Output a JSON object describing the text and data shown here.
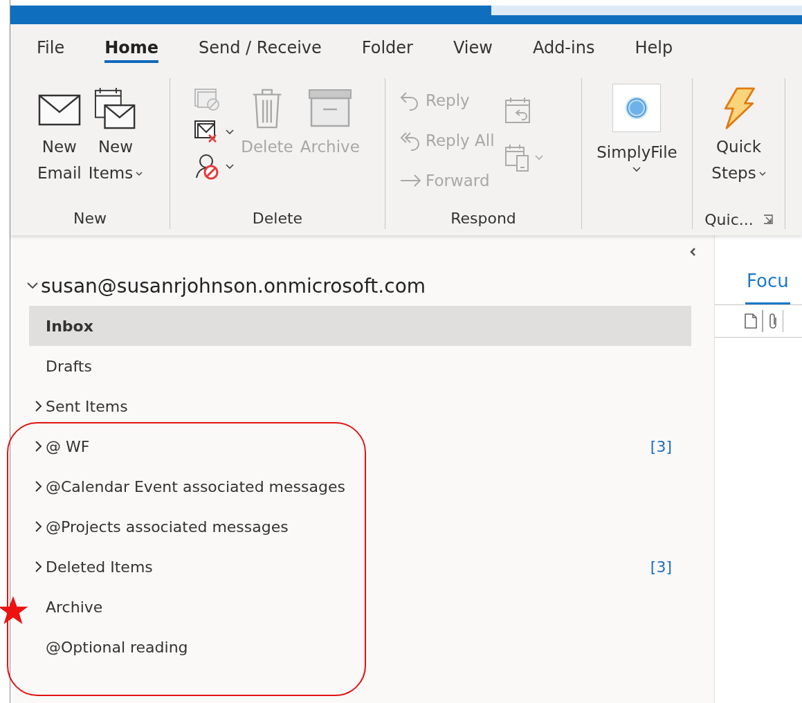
{
  "tabs": [
    {
      "label": "File",
      "selected": false
    },
    {
      "label": "Home",
      "selected": true
    },
    {
      "label": "Send / Receive",
      "selected": false
    },
    {
      "label": "Folder",
      "selected": false
    },
    {
      "label": "View",
      "selected": false
    },
    {
      "label": "Add-ins",
      "selected": false
    },
    {
      "label": "Help",
      "selected": false
    }
  ],
  "ribbon": {
    "new": {
      "label": "New",
      "new_email": {
        "lines": [
          "New",
          "Email"
        ],
        "disabled": false
      },
      "new_items": {
        "lines": [
          "New",
          "Items"
        ],
        "disabled": false
      }
    },
    "delete": {
      "label": "Delete",
      "delete": {
        "text": "Delete",
        "disabled": true
      },
      "archive": {
        "text": "Archive",
        "disabled": true
      }
    },
    "respond": {
      "label": "Respond",
      "reply": {
        "text": "Reply",
        "disabled": true
      },
      "reply_all": {
        "text": "Reply All",
        "disabled": true
      },
      "forward": {
        "text": "Forward",
        "disabled": true
      }
    },
    "simplyfile": {
      "text": "SimplyFile"
    },
    "quick_steps": {
      "lines": [
        "Quick",
        "Steps"
      ],
      "label": "Quic..."
    }
  },
  "folder_pane": {
    "account": "susan@susanrjohnson.onmicrosoft.com",
    "expanded": true,
    "folders": [
      {
        "name": "Inbox",
        "kind": "leaf",
        "selected": true
      },
      {
        "name": "Drafts",
        "kind": "leaf",
        "selected": false
      },
      {
        "name": "Sent Items",
        "kind": "collapsible",
        "selected": false
      },
      {
        "name": "@ WF",
        "kind": "collapsible",
        "selected": false,
        "count": "[3]"
      },
      {
        "name": "@Calendar Event associated messages",
        "kind": "collapsible",
        "selected": false
      },
      {
        "name": "@Projects associated messages",
        "kind": "collapsible",
        "selected": false
      },
      {
        "name": "Deleted Items",
        "kind": "collapsible",
        "selected": false,
        "count": "[3]"
      },
      {
        "name": "Archive",
        "kind": "leaf",
        "selected": false
      },
      {
        "name": "@Optional reading",
        "kind": "leaf",
        "selected": false
      }
    ]
  },
  "message_list": {
    "tab": {
      "label": "Focu",
      "selected": true
    }
  }
}
